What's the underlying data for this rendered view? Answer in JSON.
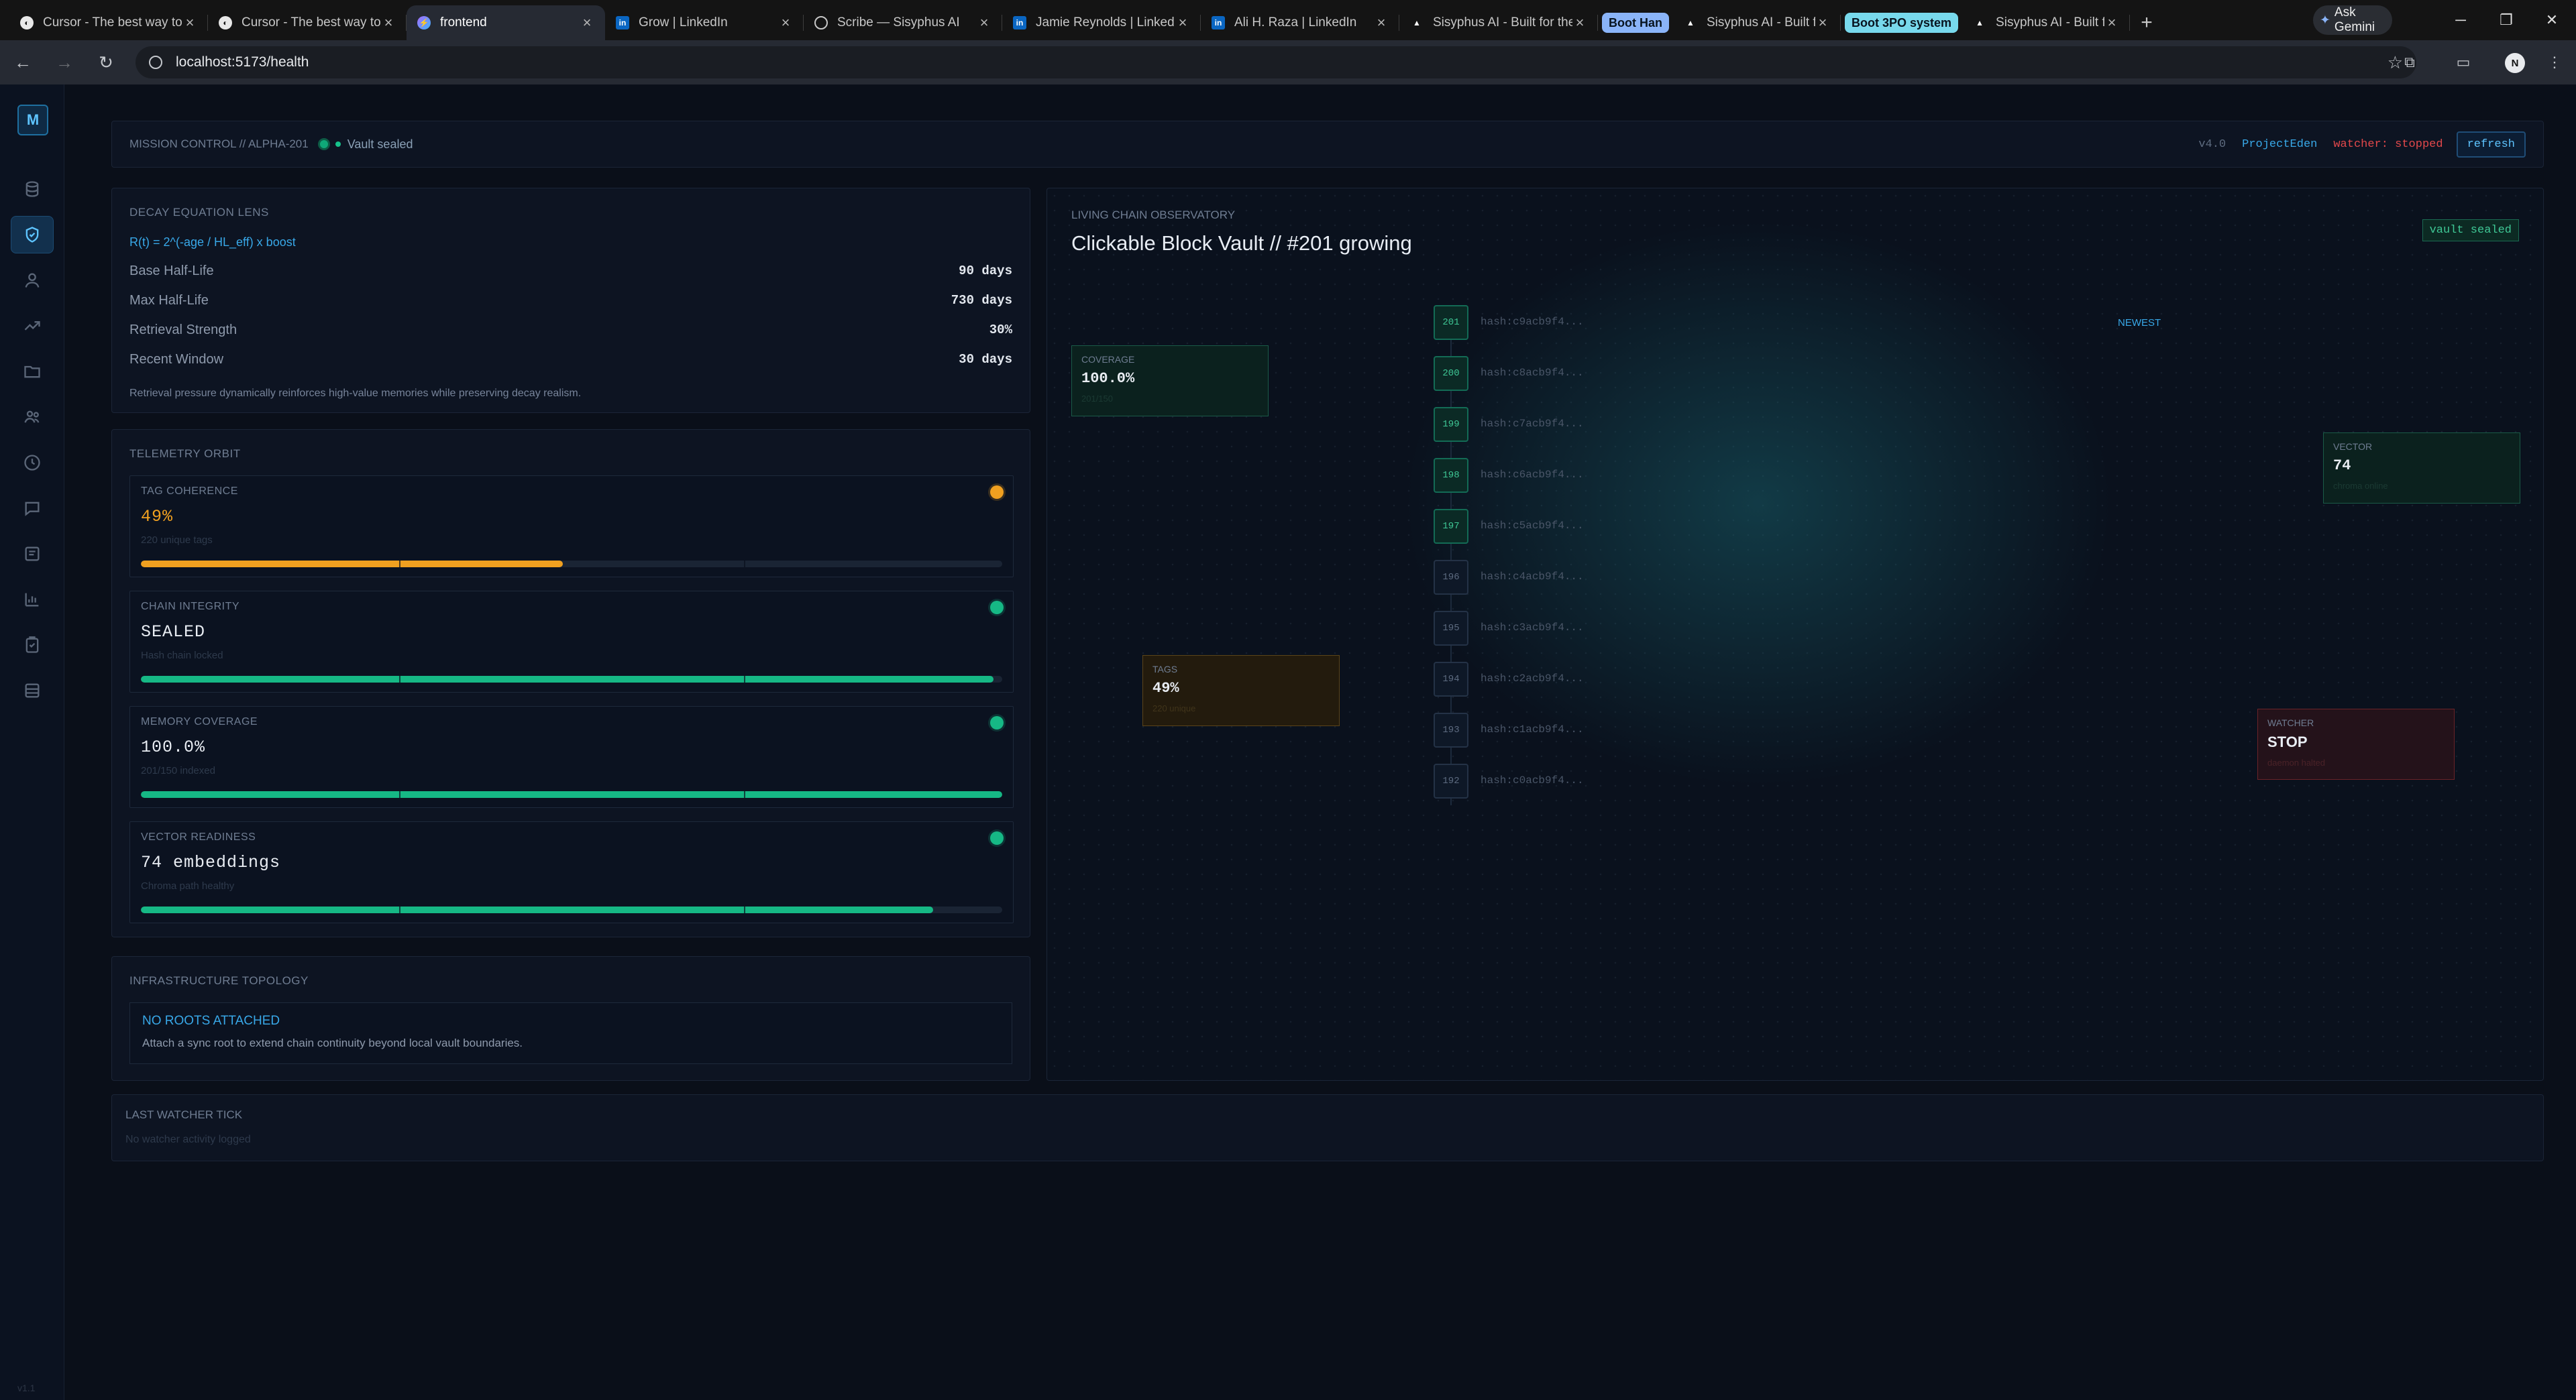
{
  "browser": {
    "tabs": [
      {
        "title": "Cursor - The best way to code",
        "fav": "cursor",
        "active": false
      },
      {
        "title": "Cursor - The best way to code",
        "fav": "cursor",
        "active": false
      },
      {
        "title": "frontend",
        "fav": "vite",
        "active": true
      },
      {
        "title": "Grow | LinkedIn",
        "fav": "in",
        "active": false
      },
      {
        "title": "Scribe — Sisyphus AI",
        "fav": "globe",
        "active": false
      },
      {
        "title": "Jamie Reynolds | LinkedIn",
        "fav": "in",
        "active": false
      },
      {
        "title": "Ali H. Raza | LinkedIn",
        "fav": "in",
        "active": false
      },
      {
        "title": "Sisyphus AI - Built for the",
        "fav": "tri",
        "active": false
      }
    ],
    "group1": "Boot Han",
    "group1_tab": "Sisyphus AI - Built for the",
    "group2": "Boot 3PO system",
    "group2_tab": "Sisyphus AI - Built for the",
    "gemini": "Ask Gemini",
    "url": "localhost:5173/health",
    "profile_initial": "N"
  },
  "app": {
    "logo": "M",
    "version": "v1.1",
    "mission": {
      "label": "MISSION CONTROL // ALPHA-201",
      "vault_status": "Vault sealed",
      "version": "v4.0",
      "project": "ProjectEden",
      "watcher": "watcher: stopped",
      "refresh": "refresh"
    },
    "decay": {
      "title": "DECAY EQUATION LENS",
      "formula": "R(t) = 2^(-age / HL_eff) x boost",
      "rows": [
        {
          "label": "Base Half-Life",
          "value": "90 days"
        },
        {
          "label": "Max Half-Life",
          "value": "730 days"
        },
        {
          "label": "Retrieval Strength",
          "value": "30%"
        },
        {
          "label": "Recent Window",
          "value": "30 days"
        }
      ],
      "note": "Retrieval pressure dynamically reinforces high-value memories while preserving decay realism."
    },
    "telemetry": {
      "title": "TELEMETRY ORBIT",
      "cards": [
        {
          "title": "TAG COHERENCE",
          "value": "49%",
          "sub": "220 unique tags",
          "fill": 0.49,
          "color": "#f0a020",
          "value_color": "#f0a020"
        },
        {
          "title": "CHAIN INTEGRITY",
          "value": "SEALED",
          "sub": "Hash chain locked",
          "fill": 0.99,
          "color": "#16b885",
          "value_color": "#e9edf3"
        },
        {
          "title": "MEMORY COVERAGE",
          "value": "100.0%",
          "sub": "201/150 indexed",
          "fill": 1.0,
          "color": "#16b885",
          "value_color": "#e9edf3"
        },
        {
          "title": "VECTOR READINESS",
          "value": "74 embeddings",
          "sub": "Chroma path healthy",
          "fill": 0.92,
          "color": "#16b885",
          "value_color": "#e9edf3"
        }
      ]
    },
    "infra": {
      "title": "INFRASTRUCTURE TOPOLOGY",
      "status": "NO ROOTS ATTACHED",
      "desc": "Attach a sync root to extend chain continuity beyond local vault boundaries."
    },
    "observatory": {
      "caption": "LIVING CHAIN OBSERVATORY",
      "title": "Clickable Block Vault // #201 growing",
      "badge": "vault sealed",
      "newest": "NEWEST",
      "blocks": [
        {
          "n": "201",
          "hash": "hash:c9acb9f4...",
          "sealed": true
        },
        {
          "n": "200",
          "hash": "hash:c8acb9f4...",
          "sealed": true
        },
        {
          "n": "199",
          "hash": "hash:c7acb9f4...",
          "sealed": true
        },
        {
          "n": "198",
          "hash": "hash:c6acb9f4...",
          "sealed": true
        },
        {
          "n": "197",
          "hash": "hash:c5acb9f4...",
          "sealed": true
        },
        {
          "n": "196",
          "hash": "hash:c4acb9f4...",
          "sealed": false
        },
        {
          "n": "195",
          "hash": "hash:c3acb9f4...",
          "sealed": false
        },
        {
          "n": "194",
          "hash": "hash:c2acb9f4...",
          "sealed": false
        },
        {
          "n": "193",
          "hash": "hash:c1acb9f4...",
          "sealed": false
        },
        {
          "n": "192",
          "hash": "hash:c0acb9f4...",
          "sealed": false
        }
      ],
      "coverage": {
        "title": "COVERAGE",
        "value": "100.0%",
        "sub": "201/150"
      },
      "vector": {
        "title": "VECTOR",
        "value": "74",
        "sub": "chroma online"
      },
      "tags": {
        "title": "TAGS",
        "value": "49%",
        "sub": "220 unique"
      },
      "watcher": {
        "title": "WATCHER",
        "value": "STOP",
        "sub": "daemon halted"
      }
    },
    "last_watch": {
      "title": "LAST WATCHER TICK",
      "status": "No watcher activity logged"
    }
  }
}
